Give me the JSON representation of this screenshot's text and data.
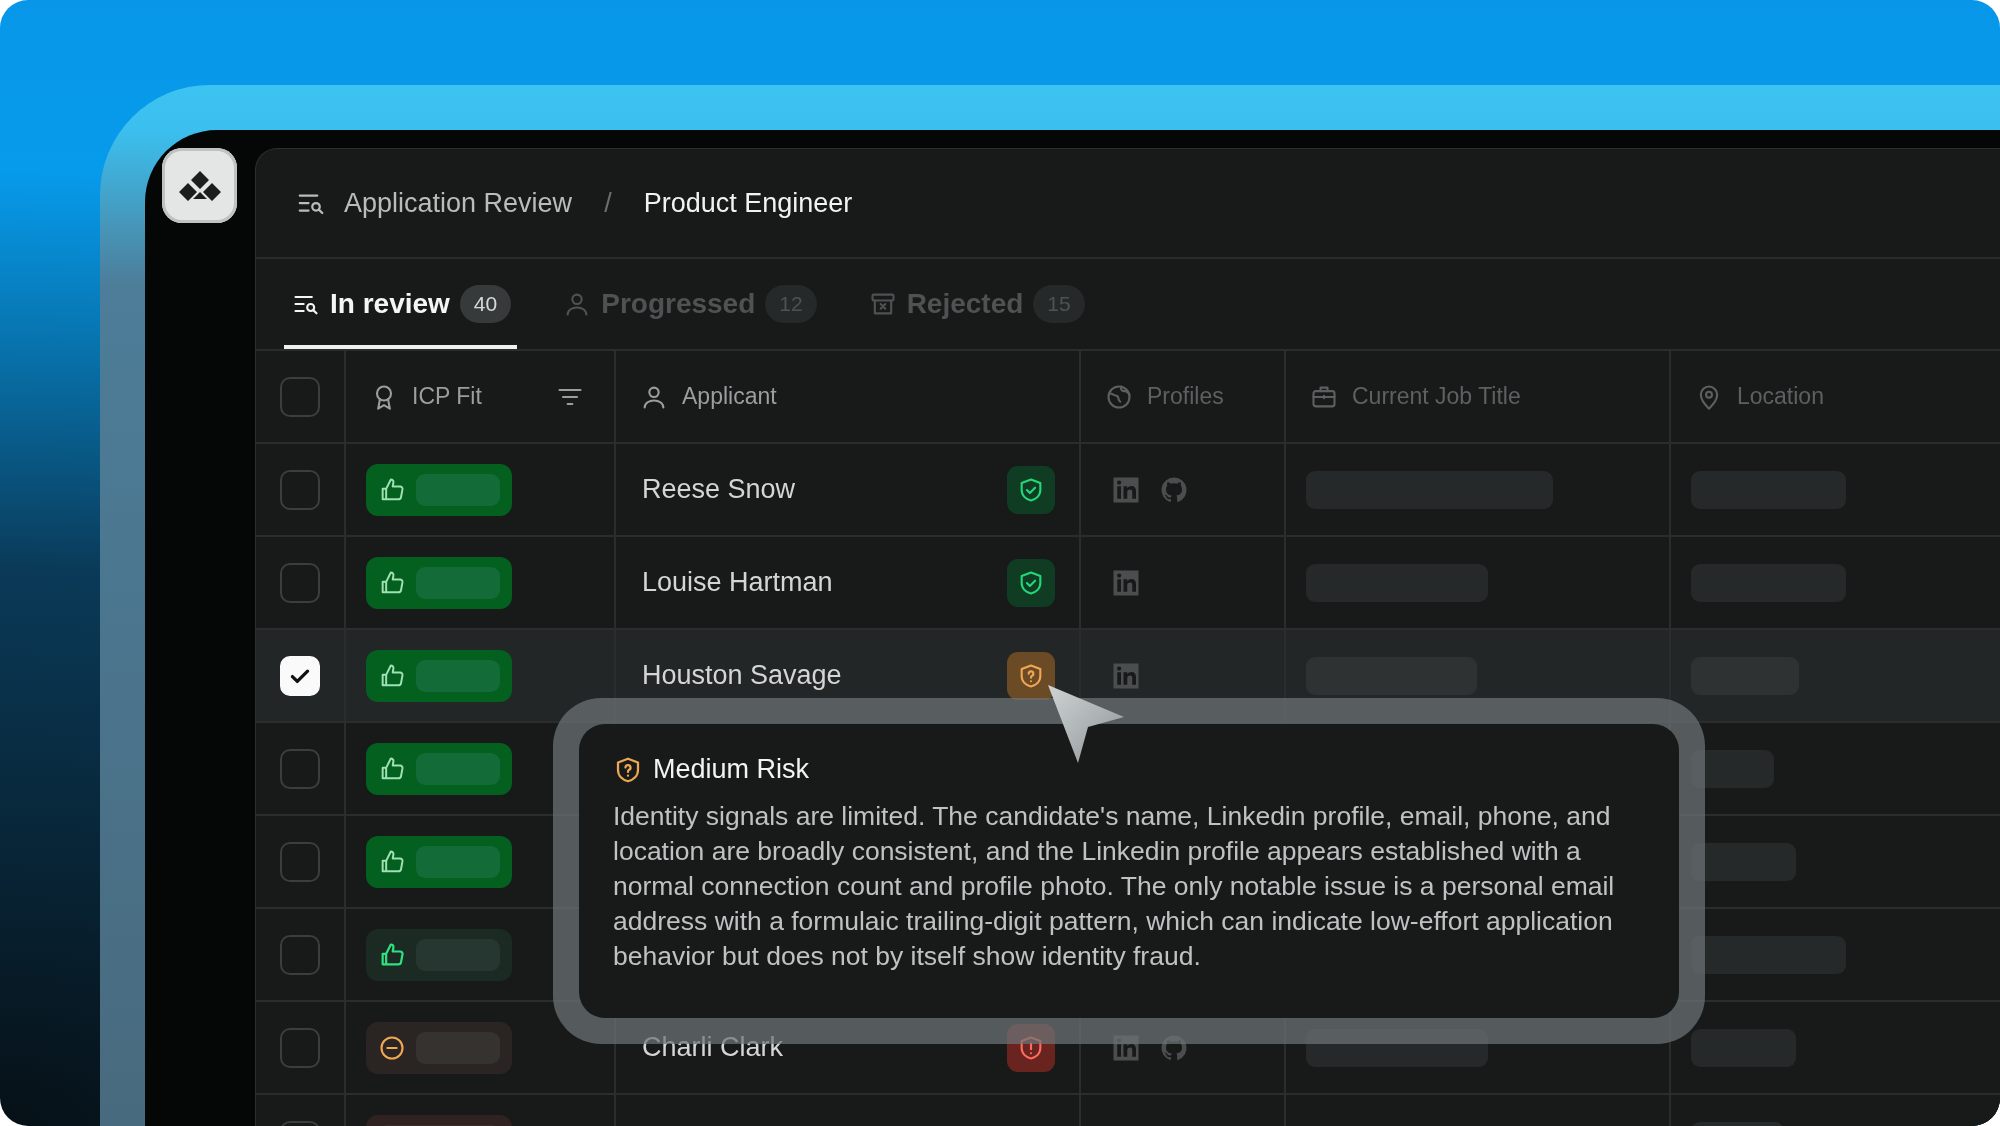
{
  "breadcrumb": {
    "parent": "Application Review",
    "separator": "/",
    "current": "Product Engineer"
  },
  "tabs": [
    {
      "label": "In review",
      "count": "40",
      "selected": true
    },
    {
      "label": "Progressed",
      "count": "12",
      "selected": false
    },
    {
      "label": "Rejected",
      "count": "15",
      "selected": false
    }
  ],
  "table": {
    "columns": [
      {
        "label": "ICP Fit",
        "filter": true
      },
      {
        "label": "Applicant",
        "filter": false
      },
      {
        "label": "Profiles",
        "filter": false
      },
      {
        "label": "Current Job Title",
        "filter": false
      },
      {
        "label": "Location",
        "filter": false
      }
    ],
    "header_checked": false,
    "rows": [
      {
        "checked": false,
        "fit": {
          "kind": "strong"
        },
        "name": "Reese Snow",
        "risk": {
          "kind": "low"
        },
        "profiles": [
          {
            "kind": "linkedin"
          },
          {
            "kind": "github"
          }
        ]
      },
      {
        "checked": false,
        "fit": {
          "kind": "strong"
        },
        "name": "Louise Hartman",
        "risk": {
          "kind": "low"
        },
        "profiles": [
          {
            "kind": "linkedin"
          }
        ]
      },
      {
        "checked": true,
        "fit": {
          "kind": "strong"
        },
        "name": "Houston Savage",
        "risk": {
          "kind": "medium"
        },
        "profiles": [
          {
            "kind": "linkedin"
          }
        ]
      },
      {
        "checked": false,
        "fit": {
          "kind": "strong"
        }
      },
      {
        "checked": false,
        "fit": {
          "kind": "strong"
        }
      },
      {
        "checked": false,
        "fit": {
          "kind": "weak"
        }
      },
      {
        "checked": false,
        "fit": {
          "kind": "neutral"
        },
        "name": "Charli Clark",
        "risk": {
          "kind": "high"
        },
        "profiles": [
          {
            "kind": "linkedin"
          },
          {
            "kind": "github"
          }
        ]
      },
      {
        "checked": false,
        "fit": {
          "kind": "negative"
        }
      }
    ]
  },
  "tooltip": {
    "kind": "medium",
    "title": "Medium Risk",
    "text": "Identity signals are limited. The candidate's name, Linkedin profile, email, phone, and location are broadly consistent, and the Linkedin profile appears established with a normal connection count and profile photo. The only notable issue is a personal email address with a formulaic trailing-digit pattern, which can indicate low-effort application behavior but does not by itself show identity fraud."
  }
}
